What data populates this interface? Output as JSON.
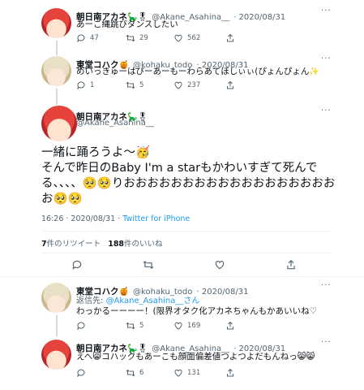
{
  "tweet1": {
    "name": "朝日南アカネ",
    "name_emoji": "🦕🎖",
    "handle": "@Akane_Asahina__",
    "date": "· 2020/08/31",
    "text": "あーこ縄跳びダンスしたい",
    "replies": "47",
    "retweets": "29",
    "likes": "562"
  },
  "tweet2": {
    "name": "東堂コハク",
    "name_emoji": "🍯",
    "handle": "@kohaku_todo",
    "date": "· 2020/08/31",
    "text": "めいっきゅーはぴーあーもーわらあてほしぃぃ(ぴょんぴょん",
    "text_emoji": "✨",
    "replies": "1",
    "retweets": "5",
    "likes": "237"
  },
  "main": {
    "name": "朝日南アカネ",
    "name_emoji": "🦕🎖",
    "handle": "@Akane_Asahina__",
    "line1": "一緒に踊ろうよ〜🥳",
    "line2": "そんで昨日のBaby I'm a starもかわいすぎて死んで",
    "line3": "る、、、、🥺🥺りおおおおおおおおおおおおおおおおおお",
    "line4": "お🥺🥺",
    "timestamp": "16:26 · 2020/08/31 · ",
    "source": "Twitter for iPhone",
    "retweet_count": "7",
    "retweet_label": "件のリツイート",
    "like_count": "188",
    "like_label": "件のいいね"
  },
  "tweet3": {
    "name": "東堂コハク",
    "name_emoji": "🍯",
    "handle": "@kohaku_todo",
    "date": "· 2020/08/31",
    "reply_prefix": "返信先: ",
    "reply_to": "@Akane_Asahina__さん",
    "text": "わっかるーーーー！(限界オタク化アカネちゃんもかあいいね♡",
    "replies": "",
    "retweets": "5",
    "likes": "169"
  },
  "tweet4": {
    "name": "朝日南アカネ",
    "name_emoji": "🦕🎖",
    "handle": "@Akane_Asahina__",
    "date": "· 2020/08/31",
    "text": "えへ😸コハックもあーこも顔面偏差値つよつよだもんねっ😸😸",
    "replies": "",
    "retweets": "6",
    "likes": "131"
  },
  "more_label": "···"
}
